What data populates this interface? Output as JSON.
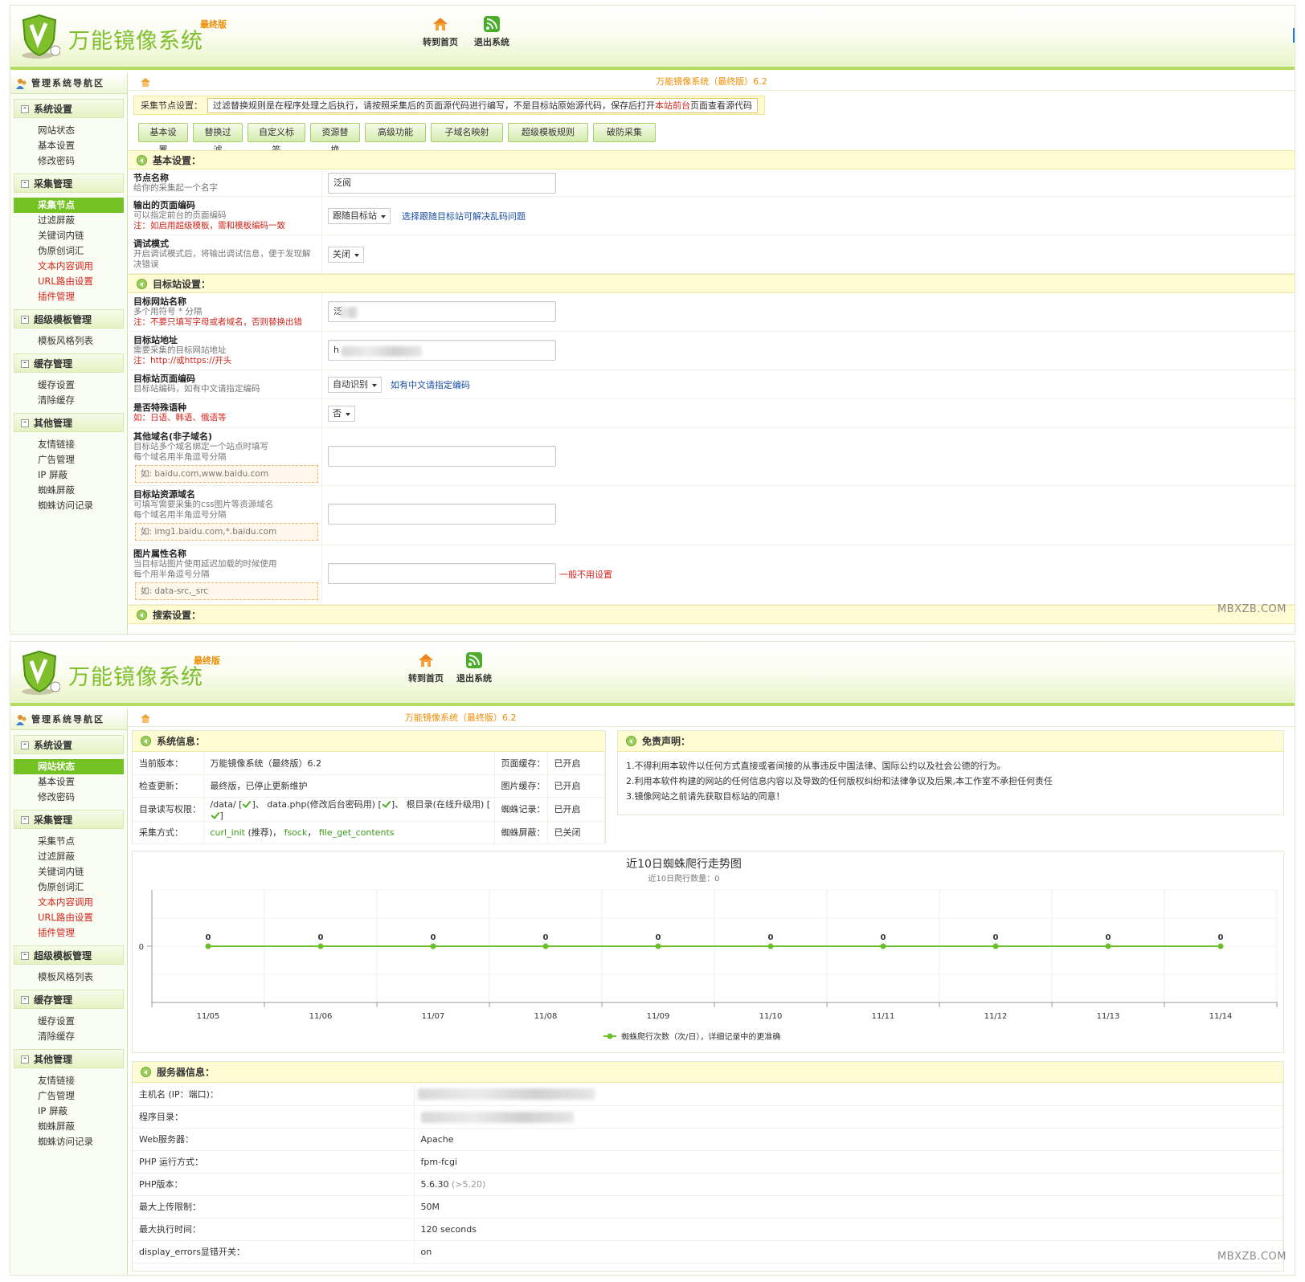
{
  "app": {
    "title": "万能镜像系统",
    "badge": "最终版",
    "nav_home": "转到首页",
    "nav_exit": "退出系统",
    "watermark": "MBXZB.COM",
    "breadcrumb": "万能镜像系统（最终版）6.2"
  },
  "sidebar": {
    "title": "管理系统导航区",
    "groups": [
      {
        "label": "系统设置",
        "items": [
          {
            "label": "网站状态"
          },
          {
            "label": "基本设置"
          },
          {
            "label": "修改密码"
          }
        ]
      },
      {
        "label": "采集管理",
        "items": [
          {
            "label": "采集节点"
          },
          {
            "label": "过滤屏蔽"
          },
          {
            "label": "关键词内链"
          },
          {
            "label": "伪原创词汇"
          },
          {
            "label": "文本内容调用"
          },
          {
            "label": "URL路由设置"
          },
          {
            "label": "插件管理"
          }
        ]
      },
      {
        "label": "超级模板管理",
        "items": [
          {
            "label": "模板风格列表"
          }
        ]
      },
      {
        "label": "缓存管理",
        "items": [
          {
            "label": "缓存设置"
          },
          {
            "label": "清除缓存"
          }
        ]
      },
      {
        "label": "其他管理",
        "items": [
          {
            "label": "友情链接"
          },
          {
            "label": "广告管理"
          },
          {
            "label": "IP 屏蔽"
          },
          {
            "label": "蜘蛛屏蔽"
          },
          {
            "label": "蜘蛛访问记录"
          }
        ]
      }
    ]
  },
  "node": {
    "notice_label": "采集节点设置：",
    "notice_pre": "过滤替换规则是在程序处理之后执行，请按照采集后的页面源代码进行编写，不是目标站原始源代码，保存后打开",
    "notice_link": "本站前台",
    "notice_post": "页面查看源代码",
    "tabs": [
      "基本设置",
      "替换过滤",
      "自定义标签",
      "资源替换",
      "高级功能",
      "子域名映射",
      "超级模板规则",
      "破防采集"
    ],
    "sections": {
      "basic": "基本设置：",
      "target": "目标站设置：",
      "search": "搜索设置："
    },
    "fields": {
      "node_name": {
        "title": "节点名称",
        "desc": "给你的采集起一个名字",
        "value": "泛阅"
      },
      "output_encoding": {
        "title": "输出的页面编码",
        "desc": "可以指定前台的页面编码",
        "note": "注：如启用超级模板，需和模板编码一致",
        "select": "跟随目标站",
        "link": "选择跟随目标站可解决乱码问题"
      },
      "debug": {
        "title": "调试模式",
        "desc": "开启调试模式后，将输出调试信息，便于发现解决错误",
        "select": "关闭"
      },
      "target_name": {
        "title": "目标网站名称",
        "desc": "多个用符号 * 分隔",
        "note": "注：不要只填写字母或者域名，否则替换出错",
        "value": "泛"
      },
      "target_url": {
        "title": "目标站地址",
        "desc": "需要采集的目标网站地址",
        "note": "注：http://或https://开头",
        "value": "h"
      },
      "target_encoding": {
        "title": "目标站页面编码",
        "desc": "目标站编码，如有中文请指定编码",
        "select": "自动识别",
        "link": "如有中文请指定编码"
      },
      "special_lang": {
        "title": "是否特殊语种",
        "note": "如：日语、韩语、俄语等",
        "select": "否"
      },
      "other_domain": {
        "title": "其他域名(非子域名)",
        "desc1": "目标站多个域名绑定一个站点时填写",
        "desc2": "每个域名用半角逗号分隔",
        "hint": "如: baidu.com,www.baidu.com"
      },
      "resource_domain": {
        "title": "目标站资源域名",
        "desc1": "可填写需要采集的css图片等资源域名",
        "desc2": "每个域名用半角逗号分隔",
        "hint": "如: img1.baidu.com,*.baidu.com"
      },
      "image_attr": {
        "title": "图片属性名称",
        "desc1": "当目标站图片使用延迟加载的时候使用",
        "desc2": "每个用半角逗号分隔",
        "hint": "如: data-src,_src",
        "note": "一般不用设置"
      }
    }
  },
  "status": {
    "sysinfo_title": "系统信息：",
    "disclaimer_title": "免责声明：",
    "rows": [
      {
        "k": "当前版本：",
        "v": "万能镜像系统（最终版）6.2",
        "k2": "页面缓存：",
        "v2": "已开启"
      },
      {
        "k": "检查更新：",
        "v": "最终版，已停止更新维护",
        "k2": "图片缓存：",
        "v2": "已开启"
      },
      {
        "k": "目录读写权限：",
        "v_a": "/data/ [",
        "v_b": "]、 data.php(修改后台密码用) [",
        "v_c": "]、 根目录(在线升级用) [",
        "v_d": "]",
        "k2": "蜘蛛记录：",
        "v2": "已开启"
      },
      {
        "k": "采集方式：",
        "v_a": "curl_init",
        "v_b": " (推荐)， ",
        "v_c": "fsock",
        "v_d": "， ",
        "v_e": "file_get_contents",
        "k2": "蜘蛛屏蔽：",
        "v2": "已关闭"
      }
    ],
    "disclaimer": [
      "1.不得利用本软件以任何方式直接或者间接的从事违反中国法律、国际公约以及社会公德的行为。",
      "2.利用本软件构建的网站的任何信息内容以及导致的任何版权纠纷和法律争议及后果,本工作室不承担任何责任",
      "3.镜像网站之前请先获取目标站的同意！"
    ],
    "server_title": "服务器信息：",
    "server_rows": [
      {
        "k": "主机名 (IP：端口)：",
        "v": ""
      },
      {
        "k": "程序目录：",
        "v": ""
      },
      {
        "k": "Web服务器：",
        "v": "Apache"
      },
      {
        "k": "PHP 运行方式：",
        "v": "fpm-fcgi"
      },
      {
        "k": "PHP版本：",
        "v": "5.6.30",
        "extra": "(>5.20)"
      },
      {
        "k": "最大上传限制：",
        "v": "50M"
      },
      {
        "k": "最大执行时间：",
        "v": "120 seconds"
      },
      {
        "k": "display_errors显错开关：",
        "v": "on"
      }
    ]
  },
  "chart_data": {
    "type": "line",
    "title": "近10日蜘蛛爬行走势图",
    "subtitle": "近10日爬行数量：0",
    "x": [
      "11/05",
      "11/06",
      "11/07",
      "11/08",
      "11/09",
      "11/10",
      "11/11",
      "11/12",
      "11/13",
      "11/14"
    ],
    "series": [
      {
        "name": "蜘蛛爬行次数（次/日），详细记录中的更准确",
        "values": [
          0,
          0,
          0,
          0,
          0,
          0,
          0,
          0,
          0,
          0
        ],
        "color": "#6cbf2a"
      }
    ],
    "y_ticks": [
      "0"
    ],
    "grid": true,
    "legend": "bottom"
  }
}
